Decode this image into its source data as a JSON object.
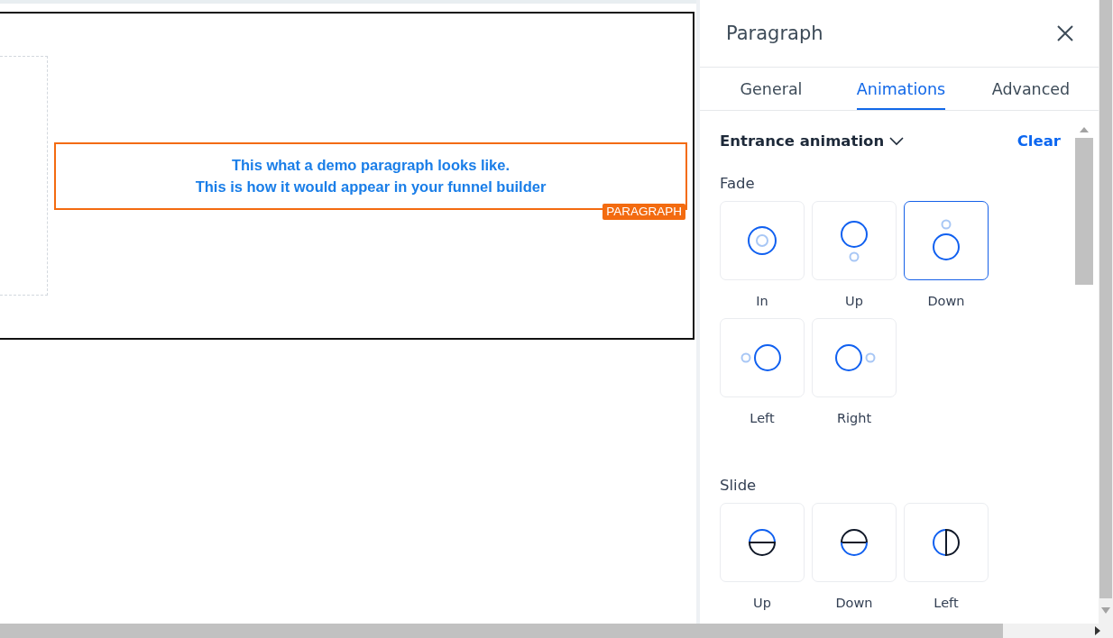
{
  "canvas": {
    "paragraph": {
      "lines": [
        "This what a demo paragraph looks like.",
        "This is how it would appear in your funnel builder"
      ],
      "badge": "PARAGRAPH"
    }
  },
  "panel": {
    "title": "Paragraph",
    "tabs": [
      {
        "label": "General",
        "selected": false
      },
      {
        "label": "Animations",
        "selected": true
      },
      {
        "label": "Advanced",
        "selected": false
      }
    ],
    "section": {
      "title": "Entrance animation",
      "clear": "Clear",
      "groups": [
        {
          "title": "Fade",
          "options": [
            {
              "label": "In",
              "kind": "fade-in",
              "selected": false
            },
            {
              "label": "Up",
              "kind": "fade-up",
              "selected": false
            },
            {
              "label": "Down",
              "kind": "fade-down",
              "selected": true
            },
            {
              "label": "Left",
              "kind": "fade-left",
              "selected": false
            },
            {
              "label": "Right",
              "kind": "fade-right",
              "selected": false
            }
          ]
        },
        {
          "title": "Slide",
          "options": [
            {
              "label": "Up",
              "kind": "slide-up",
              "selected": false
            },
            {
              "label": "Down",
              "kind": "slide-down",
              "selected": false
            },
            {
              "label": "Left",
              "kind": "slide-left",
              "selected": false
            }
          ]
        }
      ]
    }
  }
}
